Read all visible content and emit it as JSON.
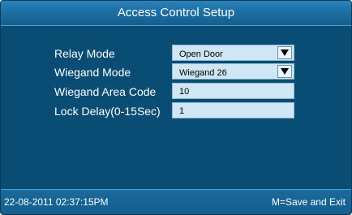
{
  "window": {
    "title": "Access Control Setup"
  },
  "form": {
    "relay_mode": {
      "label": "Relay Mode",
      "value": "Open Door",
      "arrow_icon": "triangle-down-icon"
    },
    "wiegand_mode": {
      "label": "Wiegand Mode",
      "value": "Wiegand 26",
      "arrow_icon": "triangle-down-icon"
    },
    "wiegand_area_code": {
      "label": "Wiegand Area Code",
      "value": "10"
    },
    "lock_delay": {
      "label": "Lock Delay(0-15Sec)",
      "value": "1"
    }
  },
  "status": {
    "datetime": "22-08-2011  02:37:15PM",
    "hint": "M=Save and Exit"
  },
  "colors": {
    "background": "#0a4d74",
    "titlebar": "#1d6fa3",
    "field": "#cfe6f4",
    "text": "#ffffff"
  }
}
